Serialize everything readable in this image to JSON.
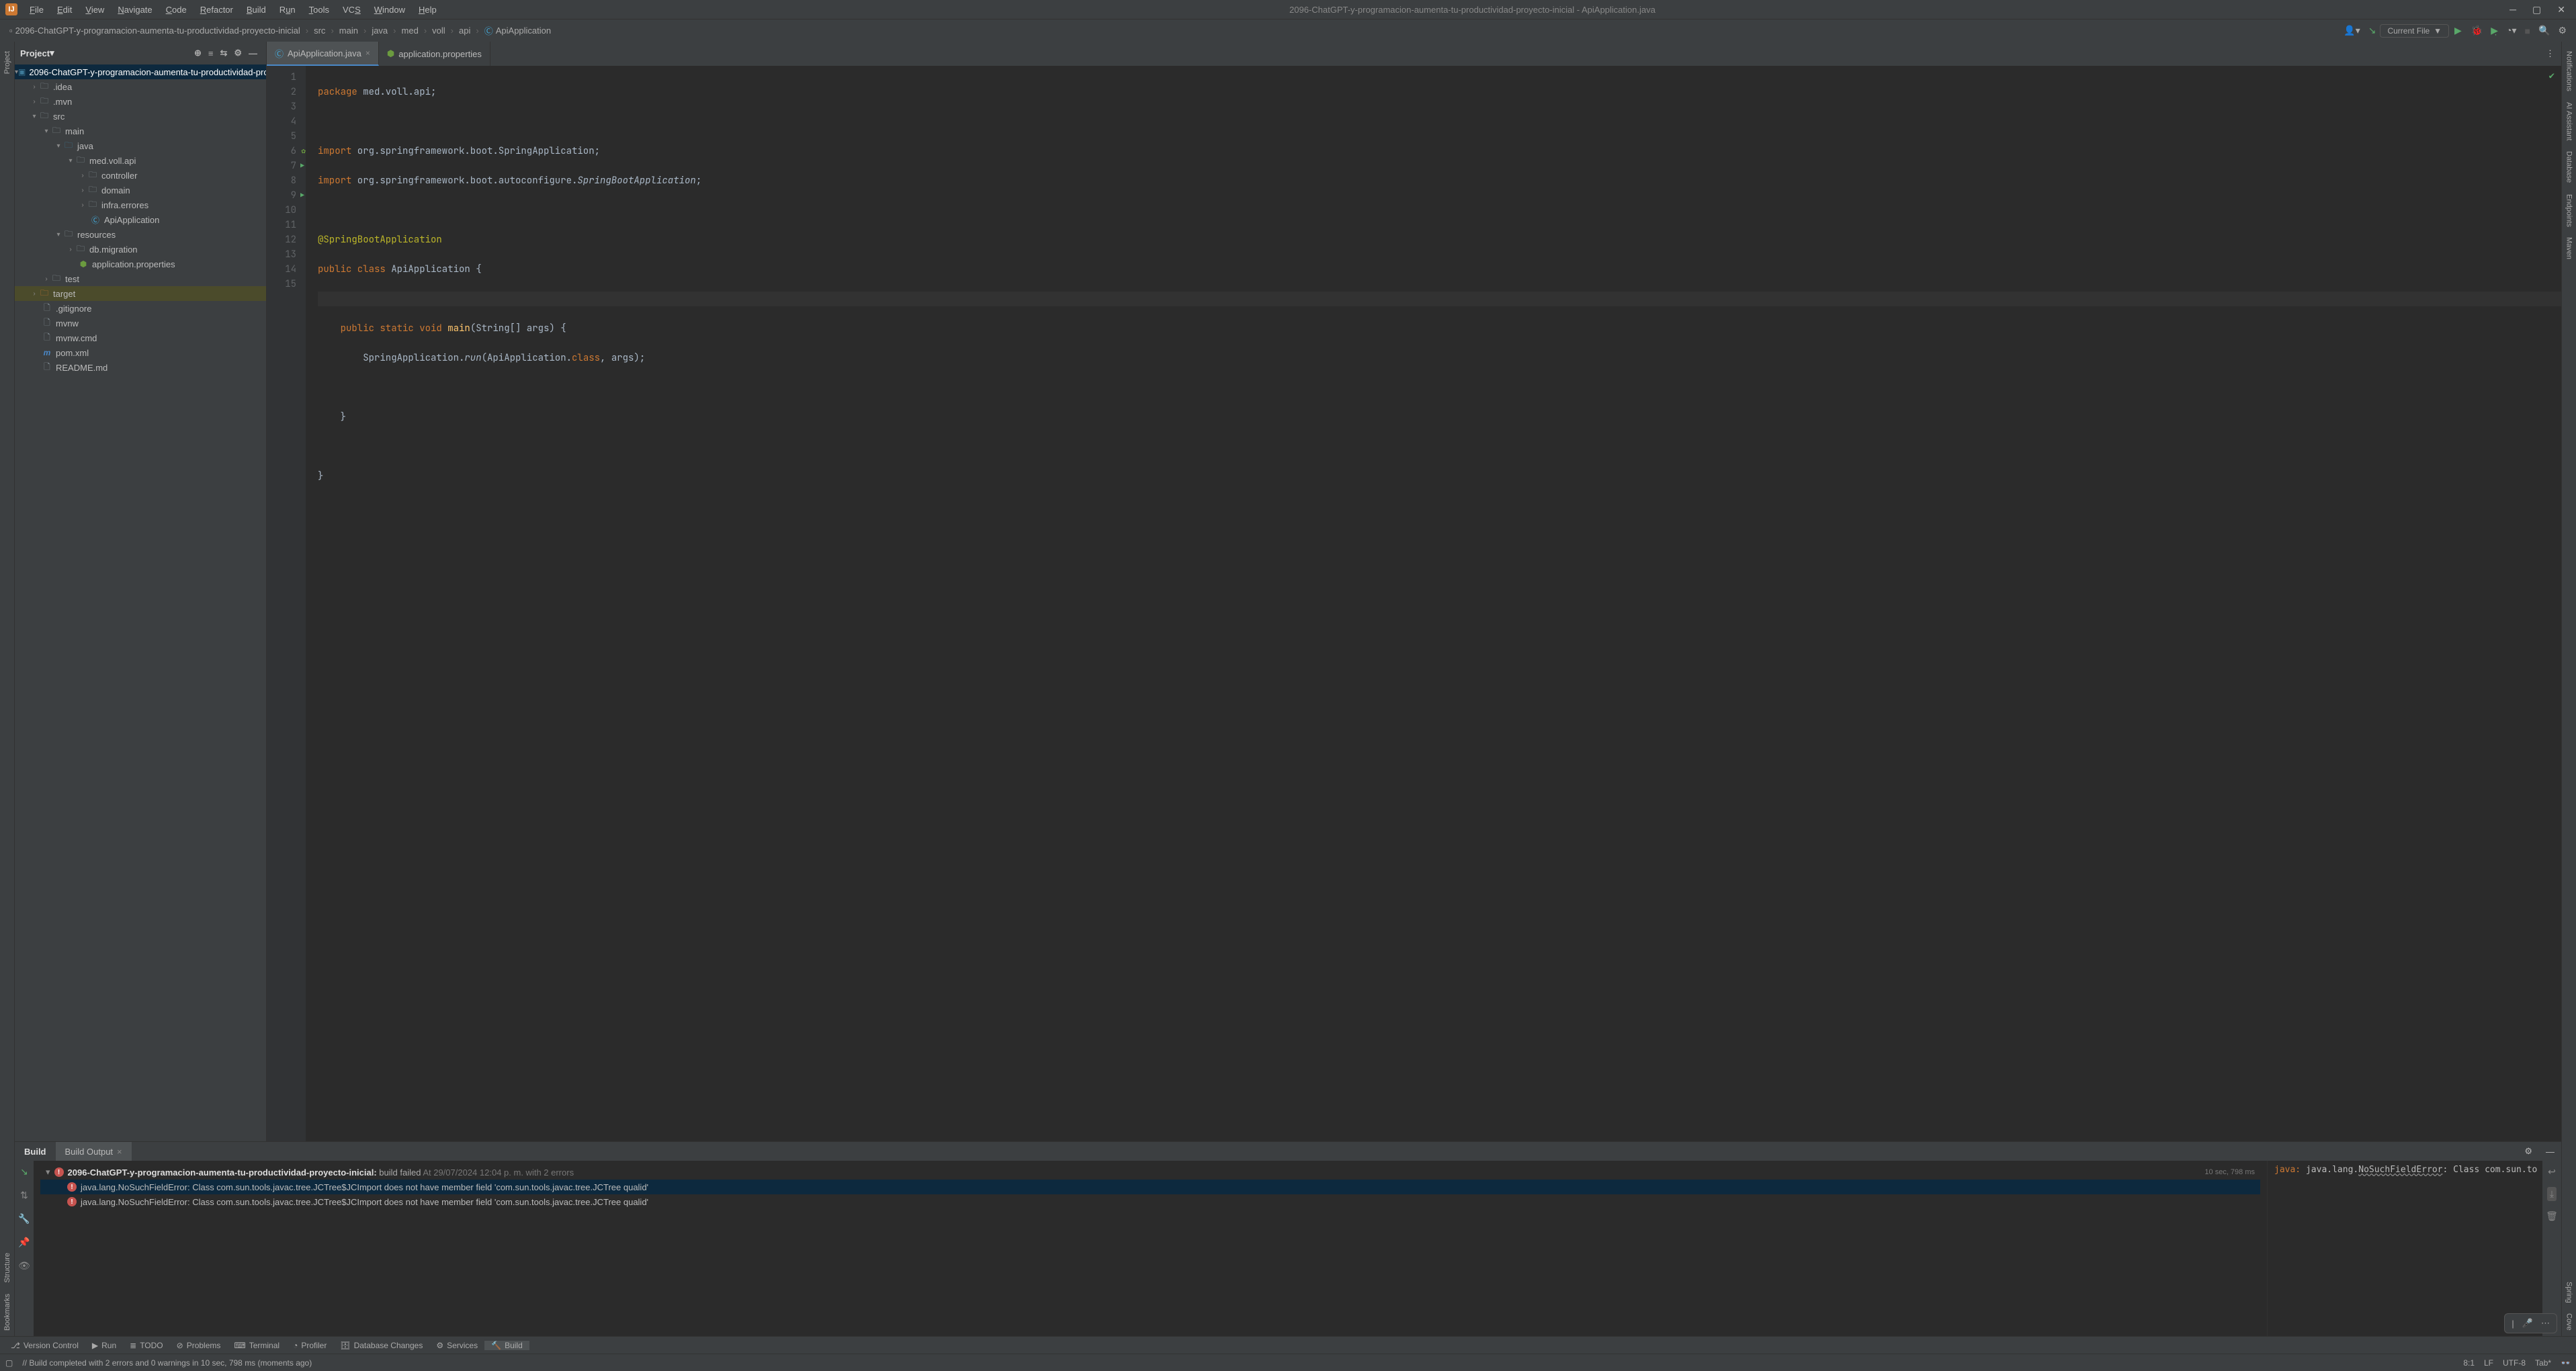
{
  "window": {
    "title": "2096-ChatGPT-y-programacion-aumenta-tu-productividad-proyecto-inicial - ApiApplication.java"
  },
  "menu": {
    "file": "File",
    "edit": "Edit",
    "view": "View",
    "navigate": "Navigate",
    "code": "Code",
    "refactor": "Refactor",
    "build": "Build",
    "run": "Run",
    "tools": "Tools",
    "vcs": "VCS",
    "window": "Window",
    "help": "Help"
  },
  "breadcrumbs": [
    "2096-ChatGPT-y-programacion-aumenta-tu-productividad-proyecto-inicial",
    "src",
    "main",
    "java",
    "med",
    "voll",
    "api",
    "ApiApplication"
  ],
  "runConfig": {
    "label": "Current File"
  },
  "projectPanel": {
    "title": "Project"
  },
  "tree": {
    "root": "2096-ChatGPT-y-programacion-aumenta-tu-productividad-pro",
    "idea": ".idea",
    "mvn": ".mvn",
    "src": "src",
    "main": "main",
    "java": "java",
    "pkg": "med.voll.api",
    "controller": "controller",
    "domain": "domain",
    "infra": "infra.errores",
    "apiApp": "ApiApplication",
    "resources": "resources",
    "dbmig": "db.migration",
    "appprops": "application.properties",
    "test": "test",
    "target": "target",
    "gitignore": ".gitignore",
    "mvnw": "mvnw",
    "mvnwcmd": "mvnw.cmd",
    "pom": "pom.xml",
    "readme": "README.md"
  },
  "editorTabs": {
    "tab1": "ApiApplication.java",
    "tab2": "application.properties"
  },
  "code": {
    "lineNumbers": [
      "1",
      "2",
      "3",
      "4",
      "5",
      "6",
      "7",
      "8",
      "9",
      "10",
      "11",
      "12",
      "13",
      "14",
      "15"
    ],
    "l1_pkg": "package",
    "l1_rest": " med.voll.api;",
    "l3_imp": "import",
    "l3_rest": " org.springframework.boot.SpringApplication;",
    "l4_imp": "import",
    "l4_rest_a": " org.springframework.boot.autoconfigure.",
    "l4_rest_b": "SpringBootApplication",
    "l4_rest_c": ";",
    "l6_ann": "@SpringBootApplication",
    "l7_a": "public class",
    "l7_b": " ApiApplication {",
    "l9_a": "public static void",
    "l9_b": " main",
    "l9_c": "(String[] args) {",
    "l10_a": "SpringApplication.",
    "l10_b": "run",
    "l10_c": "(ApiApplication.",
    "l10_d": "class",
    "l10_e": ", args);",
    "l12": "}",
    "l14": "}"
  },
  "build": {
    "tab1": "Build",
    "tab2": "Build Output",
    "headline_project": "2096-ChatGPT-y-programacion-aumenta-tu-productividad-proyecto-inicial:",
    "headline_status": " build failed",
    "headline_meta": " At 29/07/2024 12:04 p. m. with 2 errors",
    "headline_time": "10 sec, 798 ms",
    "error1": "java.lang.NoSuchFieldError: Class com.sun.tools.javac.tree.JCTree$JCImport does not have member field 'com.sun.tools.javac.tree.JCTree qualid'",
    "error2": "java.lang.NoSuchFieldError: Class com.sun.tools.javac.tree.JCTree$JCImport does not have member field 'com.sun.tools.javac.tree.JCTree qualid'",
    "detail_prefix": "java: ",
    "detail_err": "java.lang.",
    "detail_err2": "NoSuchFieldError",
    "detail_err3": ": Class com.sun.to"
  },
  "bottomBar": {
    "vcs": "Version Control",
    "run": "Run",
    "todo": "TODO",
    "problems": "Problems",
    "terminal": "Terminal",
    "profiler": "Profiler",
    "db": "Database Changes",
    "services": "Services",
    "build": "Build"
  },
  "statusBar": {
    "msg": "// Build completed with 2 errors and 0 warnings in 10 sec, 798 ms (moments ago)",
    "pos": "8:1",
    "sep": "LF",
    "enc": "UTF-8",
    "indent": "Tab*"
  },
  "leftRail": {
    "project": "Project",
    "structure": "Structure",
    "bookmarks": "Bookmarks"
  },
  "rightRail": {
    "notifications": "Notifications",
    "ai": "AI Assistant",
    "database": "Database",
    "endpoints": "Endpoints",
    "maven": "Maven",
    "spring": "Spring",
    "coverage": "Cove"
  }
}
